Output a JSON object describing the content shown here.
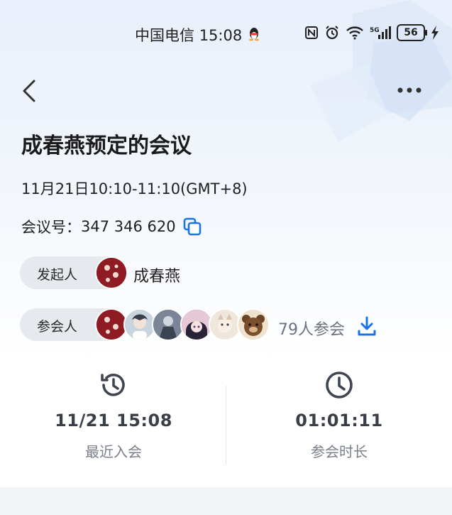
{
  "status_bar": {
    "carrier": "中国电信",
    "time": "15:08",
    "battery": "56"
  },
  "nav": {
    "back_icon": "chevron-left-icon",
    "more_icon": "more-dots-icon"
  },
  "meeting": {
    "title": "成春燕预定的会议",
    "time_range": "11月21日10:10-11:10(GMT+8)",
    "id_label": "会议号：",
    "id_value": "347 346 620"
  },
  "host": {
    "label": "发起人",
    "name": "成春燕"
  },
  "participants": {
    "label": "参会人",
    "count": "79人参会"
  },
  "stats": {
    "last_join_value": "11/21 15:08",
    "last_join_label": "最近入会",
    "duration_value": "01:01:11",
    "duration_label": "参会时长"
  },
  "colors": {
    "accent": "#1a73e8",
    "pill_bg": "#e6e9ee",
    "muted_text": "#7a808a"
  }
}
